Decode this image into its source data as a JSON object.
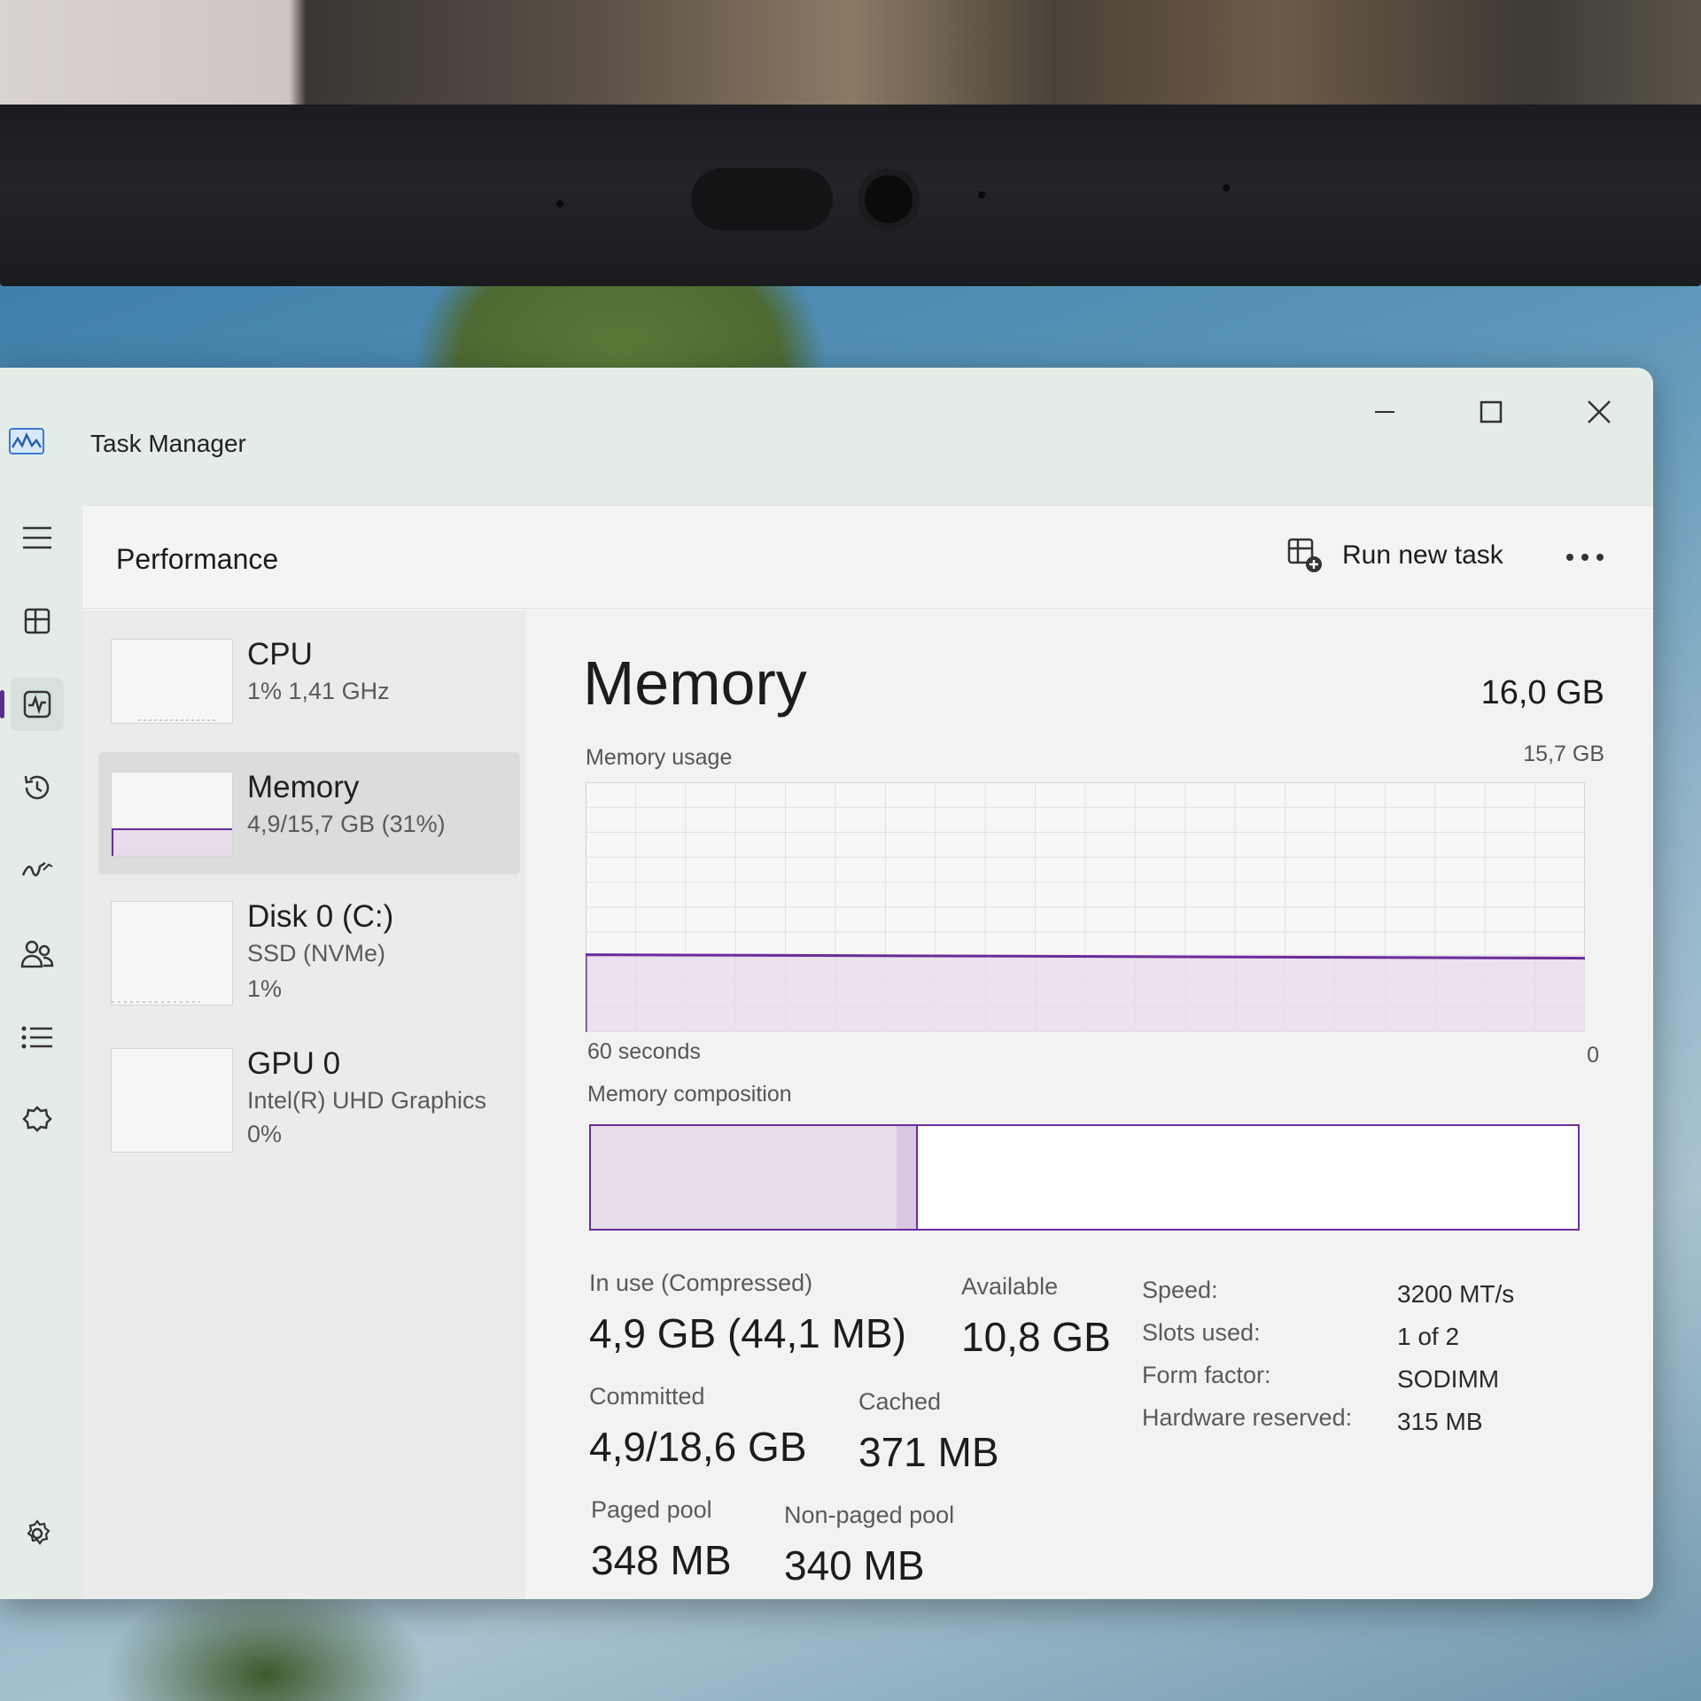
{
  "window": {
    "title": "Task Manager"
  },
  "nav": {
    "items": [
      {
        "icon": "menu-icon"
      },
      {
        "icon": "processes-icon"
      },
      {
        "icon": "performance-icon",
        "active": true
      },
      {
        "icon": "app-history-icon"
      },
      {
        "icon": "startup-apps-icon"
      },
      {
        "icon": "users-icon"
      },
      {
        "icon": "details-icon"
      },
      {
        "icon": "services-icon"
      }
    ],
    "settings_icon": "settings-icon"
  },
  "header": {
    "page_title": "Performance",
    "run_task_label": "Run new task",
    "more_icon": "more-options-icon"
  },
  "devices": [
    {
      "name": "CPU",
      "line1": "1%  1,41 GHz",
      "line2": ""
    },
    {
      "name": "Memory",
      "line1": "4,9/15,7 GB (31%)",
      "line2": "",
      "selected": true
    },
    {
      "name": "Disk 0 (C:)",
      "line1": "SSD (NVMe)",
      "line2": "1%"
    },
    {
      "name": "GPU 0",
      "line1": "Intel(R) UHD Graphics",
      "line2": "0%"
    }
  ],
  "memory": {
    "title": "Memory",
    "total": "16,0 GB",
    "usage_label": "Memory usage",
    "usage_max": "15,7 GB",
    "axis_left": "60 seconds",
    "axis_right": "0",
    "composition_label": "Memory composition",
    "usage_fraction": 0.31,
    "composition": {
      "in_use_fraction": 0.31,
      "modified_fraction": 0.02
    },
    "stats": {
      "in_use": {
        "label": "In use (Compressed)",
        "value": "4,9 GB (44,1 MB)"
      },
      "available": {
        "label": "Available",
        "value": "10,8 GB"
      },
      "committed": {
        "label": "Committed",
        "value": "4,9/18,6 GB"
      },
      "cached": {
        "label": "Cached",
        "value": "371 MB"
      },
      "paged_pool": {
        "label": "Paged pool",
        "value": "348 MB"
      },
      "non_paged_pool": {
        "label": "Non-paged pool",
        "value": "340 MB"
      }
    },
    "specs": [
      {
        "key": "Speed:",
        "value": "3200 MT/s"
      },
      {
        "key": "Slots used:",
        "value": "1 of 2"
      },
      {
        "key": "Form factor:",
        "value": "SODIMM"
      },
      {
        "key": "Hardware reserved:",
        "value": "315 MB"
      }
    ]
  },
  "colors": {
    "accent": "#6a2c9b",
    "fill": "#e7dcea"
  }
}
